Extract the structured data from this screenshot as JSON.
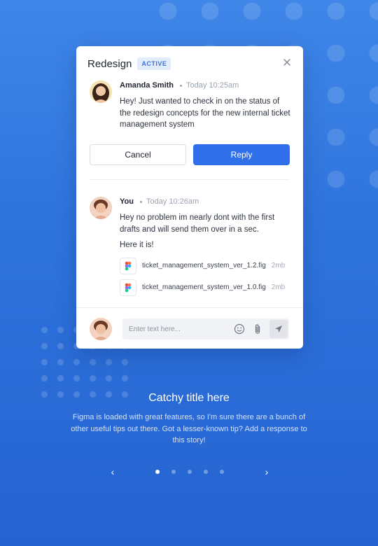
{
  "card": {
    "title": "Redesign",
    "badge": "ACTIVE",
    "actions": {
      "cancel_label": "Cancel",
      "reply_label": "Reply"
    }
  },
  "messages": [
    {
      "author": "Amanda Smith",
      "time": "Today 10:25am",
      "text": "Hey! Just wanted to check in on the status of the redesign concepts for the new internal ticket management system"
    },
    {
      "author": "You",
      "time": "Today 10:26am",
      "text": "Hey no problem im nearly dont with the first drafts and will send them over in a sec.",
      "text2": "Here it is!",
      "attachments": [
        {
          "name": "ticket_management_system_ver_1.2.fig",
          "size": "2mb"
        },
        {
          "name": "ticket_management_system_ver_1.0.fig",
          "size": "2mb"
        }
      ]
    }
  ],
  "composer": {
    "placeholder": "Enter text here..."
  },
  "promo": {
    "title": "Catchy title here",
    "body": "Figma is loaded with great features, so I'm sure there are a bunch of other useful tips out there. Got a lesser-known tip? Add a response to this story!"
  },
  "pager": {
    "prev": "‹",
    "next": "›",
    "active_index": 0,
    "count": 5
  },
  "colors": {
    "accent": "#2f6fea",
    "background": "#2f74dd",
    "badge_bg": "#e3ecfb"
  },
  "icons": [
    "close-icon",
    "emoji-icon",
    "attachment-icon",
    "send-icon",
    "figma-file-icon"
  ]
}
